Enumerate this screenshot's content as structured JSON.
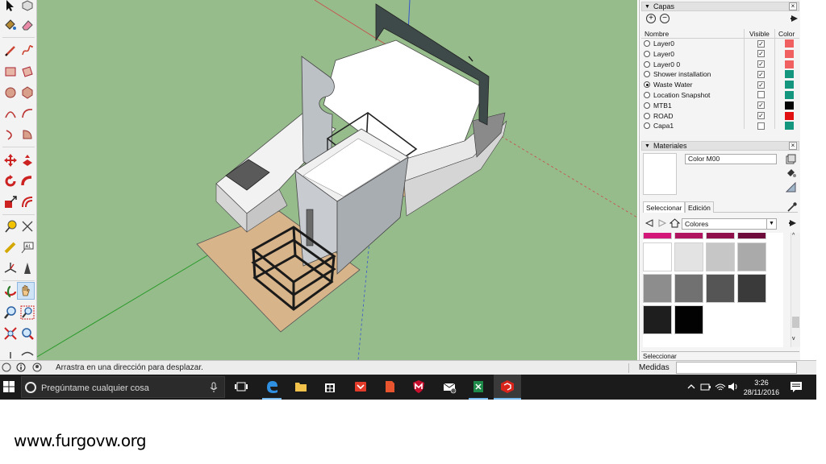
{
  "layers_panel": {
    "title": "Capas",
    "close": "×",
    "columns": {
      "name": "Nombre",
      "visible": "Visible",
      "color": "Color"
    },
    "rows": [
      {
        "name": "Layer0",
        "visible": true,
        "active": false,
        "color": "#f06060"
      },
      {
        "name": "Layer0",
        "visible": true,
        "active": false,
        "color": "#f06060"
      },
      {
        "name": "Layer0 0",
        "visible": true,
        "active": false,
        "color": "#f06060"
      },
      {
        "name": "Shower installation",
        "visible": true,
        "active": false,
        "color": "#14967e"
      },
      {
        "name": "Waste Water",
        "visible": true,
        "active": true,
        "color": "#14967e"
      },
      {
        "name": "Location Snapshot",
        "visible": false,
        "active": false,
        "color": "#14967e"
      },
      {
        "name": "MTB1",
        "visible": true,
        "active": false,
        "color": "#050505"
      },
      {
        "name": "ROAD",
        "visible": true,
        "active": false,
        "color": "#e01010"
      },
      {
        "name": "Capa1",
        "visible": false,
        "active": false,
        "color": "#14967e"
      }
    ],
    "check_glyph": "✓"
  },
  "materials_panel": {
    "title": "Materiales",
    "close": "×",
    "material_name": "Color M00",
    "tabs": {
      "select": "Seleccionar",
      "edit": "Edición"
    },
    "library": "Colores",
    "swatches_top": [
      "#d4187a",
      "#b0145f",
      "#8e0f4a",
      "#6d0c3b"
    ],
    "swatches": [
      "#ffffff",
      "#e3e3e3",
      "#c6c6c6",
      "#aaaaaa",
      "#8d8d8d",
      "#717171",
      "#555555",
      "#3a3a3a",
      "#1e1e1e",
      "#020202"
    ]
  },
  "bottom_strip": "Seleccionar",
  "status": {
    "message": "Arrastra en una dirección para desplazar.",
    "measurements_label": "Medidas"
  },
  "taskbar": {
    "search_placeholder": "Pregúntame cualquier cosa",
    "time": "3:26",
    "date": "28/11/2016"
  },
  "watermark": "www.furgovw.org"
}
